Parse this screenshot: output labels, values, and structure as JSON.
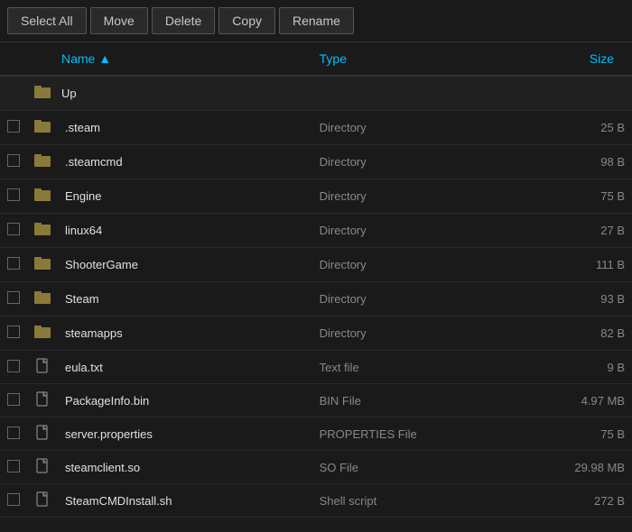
{
  "toolbar": {
    "buttons": [
      {
        "label": "Select All",
        "name": "select-all-button"
      },
      {
        "label": "Move",
        "name": "move-button"
      },
      {
        "label": "Delete",
        "name": "delete-button"
      },
      {
        "label": "Copy",
        "name": "copy-button"
      },
      {
        "label": "Rename",
        "name": "rename-button"
      }
    ]
  },
  "table": {
    "columns": [
      {
        "label": "Name ▲",
        "name": "name-column"
      },
      {
        "label": "Type",
        "name": "type-column"
      },
      {
        "label": "Size",
        "name": "size-column"
      }
    ],
    "up_row": {
      "name": "Up"
    },
    "rows": [
      {
        "name": ".steam",
        "type": "Directory",
        "size": "25 B",
        "icon": "folder"
      },
      {
        "name": ".steamcmd",
        "type": "Directory",
        "size": "98 B",
        "icon": "folder"
      },
      {
        "name": "Engine",
        "type": "Directory",
        "size": "75 B",
        "icon": "folder"
      },
      {
        "name": "linux64",
        "type": "Directory",
        "size": "27 B",
        "icon": "folder"
      },
      {
        "name": "ShooterGame",
        "type": "Directory",
        "size": "111 B",
        "icon": "folder"
      },
      {
        "name": "Steam",
        "type": "Directory",
        "size": "93 B",
        "icon": "folder"
      },
      {
        "name": "steamapps",
        "type": "Directory",
        "size": "82 B",
        "icon": "folder"
      },
      {
        "name": "eula.txt",
        "type": "Text file",
        "size": "9 B",
        "icon": "file"
      },
      {
        "name": "PackageInfo.bin",
        "type": "BIN File",
        "size": "4.97 MB",
        "icon": "file"
      },
      {
        "name": "server.properties",
        "type": "PROPERTIES File",
        "size": "75 B",
        "icon": "file"
      },
      {
        "name": "steamclient.so",
        "type": "SO File",
        "size": "29.98 MB",
        "icon": "file"
      },
      {
        "name": "SteamCMDInstall.sh",
        "type": "Shell script",
        "size": "272 B",
        "icon": "file"
      }
    ]
  },
  "icons": {
    "folder": "🗂",
    "file": "📄",
    "checkbox_empty": ""
  }
}
